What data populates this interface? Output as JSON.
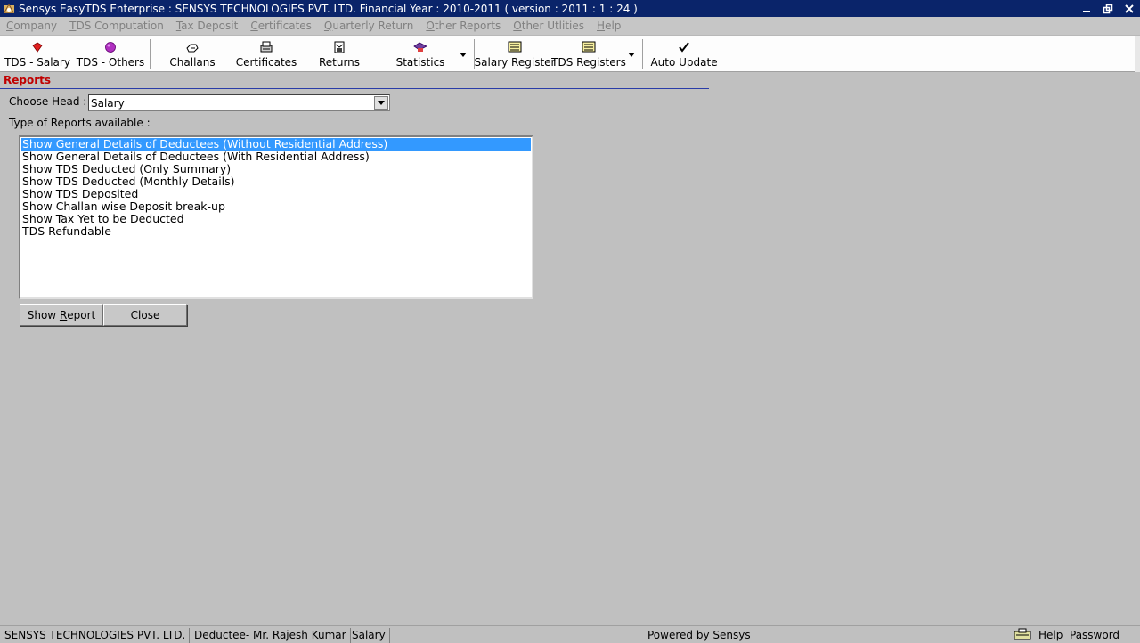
{
  "window": {
    "title": "Sensys EasyTDS Enterprise : SENSYS TECHNOLOGIES PVT. LTD. Financial Year : 2010-2011 ( version : 2011 : 1 : 24 )",
    "minimize": "▬",
    "restore": "❐",
    "close": "✕"
  },
  "menu": [
    {
      "pre": "",
      "ul": "C",
      "post": "ompany"
    },
    {
      "pre": "",
      "ul": "T",
      "post": "DS Computation"
    },
    {
      "pre": "",
      "ul": "T",
      "post": "ax Deposit"
    },
    {
      "pre": "",
      "ul": "C",
      "post": "ertificates"
    },
    {
      "pre": "",
      "ul": "Q",
      "post": "uarterly Return"
    },
    {
      "pre": "",
      "ul": "O",
      "post": "ther Reports"
    },
    {
      "pre": "",
      "ul": "O",
      "post": "ther Utlities"
    },
    {
      "pre": "",
      "ul": "H",
      "post": "elp"
    }
  ],
  "toolbar": {
    "tds_salary": "TDS - Salary",
    "tds_others": "TDS - Others",
    "challans": "Challans",
    "certificates": "Certificates",
    "returns": "Returns",
    "statistics": "Statistics",
    "salary_register": "Salary Register",
    "tds_registers": "TDS Registers",
    "auto_update": "Auto Update"
  },
  "reports": {
    "title": "Reports",
    "choose_head_label": "Choose Head :",
    "choose_head_value": "Salary",
    "types_label": "Type of Reports available :",
    "items": [
      "Show General Details of Deductees (Without Residential Address)",
      "Show General Details of Deductees (With Residential Address)",
      "Show TDS Deducted (Only Summary)",
      "Show TDS Deducted (Monthly Details)",
      "Show TDS Deposited",
      "Show Challan wise Deposit break-up",
      "Show Tax Yet to be Deducted",
      "TDS Refundable"
    ],
    "selected_index": 0,
    "show_report_pre": "Show ",
    "show_report_ul": "R",
    "show_report_post": "eport",
    "close": "Close"
  },
  "status": {
    "company": "SENSYS TECHNOLOGIES PVT. LTD.",
    "deductee": "Deductee- Mr. Rajesh  Kumar",
    "head": "Salary",
    "powered": "Powered by Sensys",
    "help": "Help",
    "password": "Password"
  }
}
